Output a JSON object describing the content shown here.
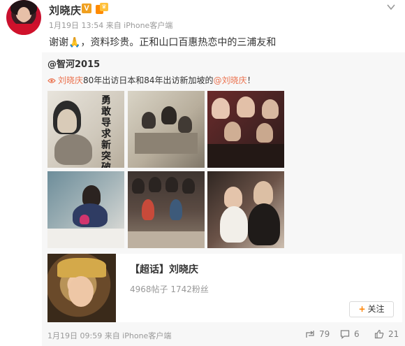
{
  "post": {
    "author": "刘晓庆",
    "verified_badge": "V",
    "meta": "1月19日 13:54 来自 iPhone客户端",
    "text": "谢谢🙏，资料珍贵。正和山口百惠热恋中的三浦友和"
  },
  "repost": {
    "author": "@智河2015",
    "prefix_link": "刘晓庆",
    "middle_text": "80年出访日本和84年出访新加坡的",
    "mention": "@刘晓庆",
    "suffix": "！",
    "photo_caption": "勇敢导求新突破"
  },
  "super_topic": {
    "title": "【超话】刘晓庆",
    "stats": "4968帖子 1742粉丝",
    "follow_label": "关注"
  },
  "footer": {
    "time": "1月19日 09:59 来自 iPhone客户端",
    "reposts": "79",
    "comments": "6",
    "likes": "21"
  },
  "colors": {
    "link": "#eb7350",
    "follow_plus": "#ff8200",
    "verified": "#f0a020",
    "repost_bg": "#f7f7f7"
  },
  "icons": [
    "chevron-down-icon",
    "verified-badge-icon",
    "rank-badge-icon",
    "eye-icon",
    "repost-icon",
    "comment-icon",
    "like-icon"
  ]
}
